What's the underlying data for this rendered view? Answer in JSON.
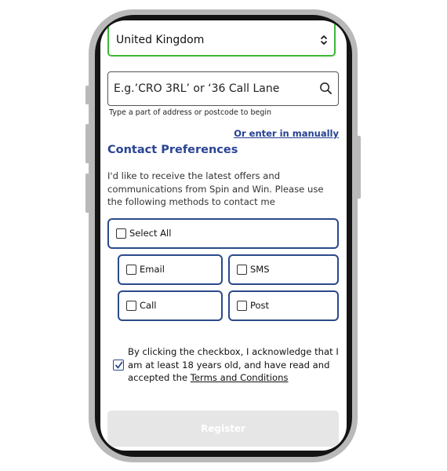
{
  "form": {
    "country_value": "United Kingdom",
    "address_placeholder": "E.g.’CRO 3RL’ or ‘36 Call Lane",
    "address_hint": "Type a part of address or postcode to begin",
    "manual_link": "Or enter in manually"
  },
  "preferences": {
    "heading": "Contact Preferences",
    "intro": "I'd like to receive the latest offers and communications from Spin and Win. Please use the following methods to contact me",
    "select_all": "Select All",
    "email": "Email",
    "sms": "SMS",
    "call": "Call",
    "post": "Post"
  },
  "consent": {
    "text_before": "By clicking the checkbox, I acknowledge that I am at least 18 years old, and have read and accepted the ",
    "terms_link": "Terms and Conditions",
    "checked": true
  },
  "register_label": "Register",
  "colors": {
    "accent_blue": "#2a4494",
    "country_border": "#3db835",
    "checkbox_check": "#2b4a8a",
    "register_bg": "#e6e6e6"
  }
}
